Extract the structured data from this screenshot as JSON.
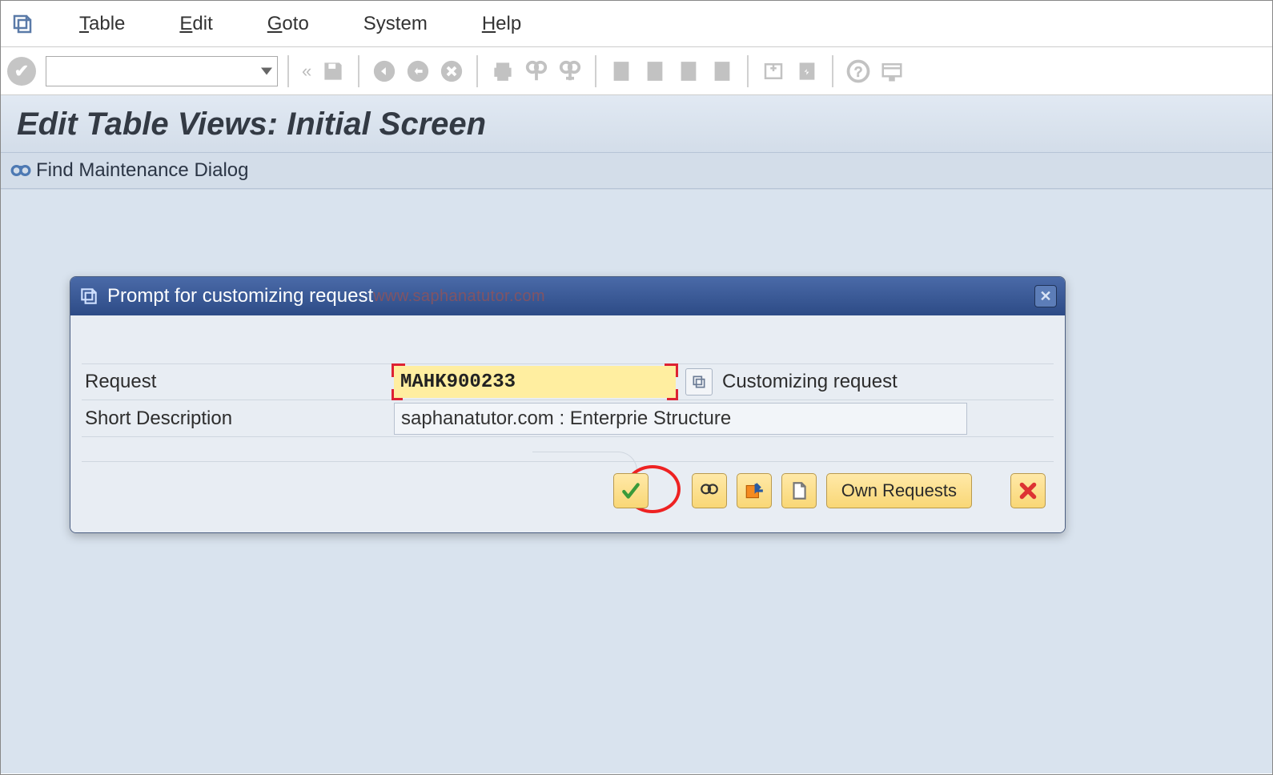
{
  "menubar": {
    "items": [
      "Table",
      "Edit",
      "Goto",
      "System",
      "Help"
    ]
  },
  "toolbar": {
    "command_value": ""
  },
  "page": {
    "title": "Edit Table Views: Initial Screen",
    "sub_toolbar_label": "Find Maintenance Dialog"
  },
  "dialog": {
    "title": "Prompt for customizing request",
    "watermark": "www.saphanatutor.com",
    "fields": {
      "request_label": "Request",
      "request_value": "MAHK900233",
      "request_after_label": "Customizing request",
      "short_desc_label": "Short Description",
      "short_desc_value": "saphanatutor.com : Enterprie Structure"
    },
    "footer": {
      "own_requests_label": "Own Requests"
    }
  }
}
